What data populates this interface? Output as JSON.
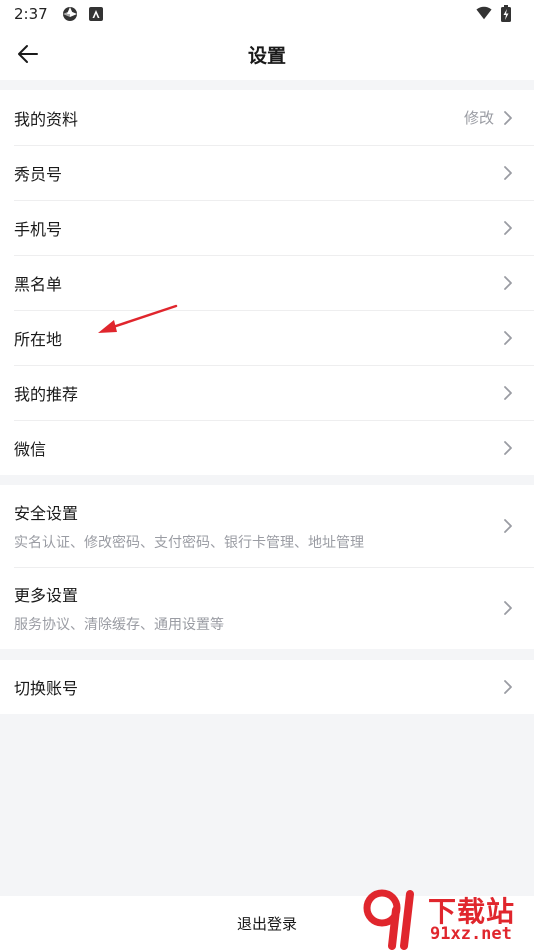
{
  "status_bar": {
    "time": "2:37",
    "icons_left": [
      "aperture-icon",
      "app-notification-icon"
    ],
    "icons_right": [
      "wifi-icon",
      "battery-charging-icon"
    ]
  },
  "header": {
    "title": "设置",
    "back_icon": "arrow-left-icon"
  },
  "groups": {
    "profile": {
      "items": [
        {
          "label": "我的资料",
          "value": "修改"
        },
        {
          "label": "秀员号"
        },
        {
          "label": "手机号"
        },
        {
          "label": "黑名单"
        },
        {
          "label": "所在地"
        },
        {
          "label": "我的推荐"
        },
        {
          "label": "微信"
        }
      ]
    },
    "settings": {
      "items": [
        {
          "label": "安全设置",
          "sub": "实名认证、修改密码、支付密码、银行卡管理、地址管理"
        },
        {
          "label": "更多设置",
          "sub": "服务协议、清除缓存、通用设置等"
        }
      ]
    },
    "account": {
      "items": [
        {
          "label": "切换账号"
        }
      ]
    }
  },
  "footer": {
    "logout_label": "退出登录"
  },
  "annotation": {
    "color": "#e0262d"
  },
  "watermark": {
    "brand": "下载站",
    "domain": "91xz.net",
    "color": "#e0262d"
  },
  "colors": {
    "background": "#f4f5f7",
    "card": "#ffffff",
    "secondary_text": "#9a9ca3",
    "primary_text": "#1a1a1a"
  }
}
